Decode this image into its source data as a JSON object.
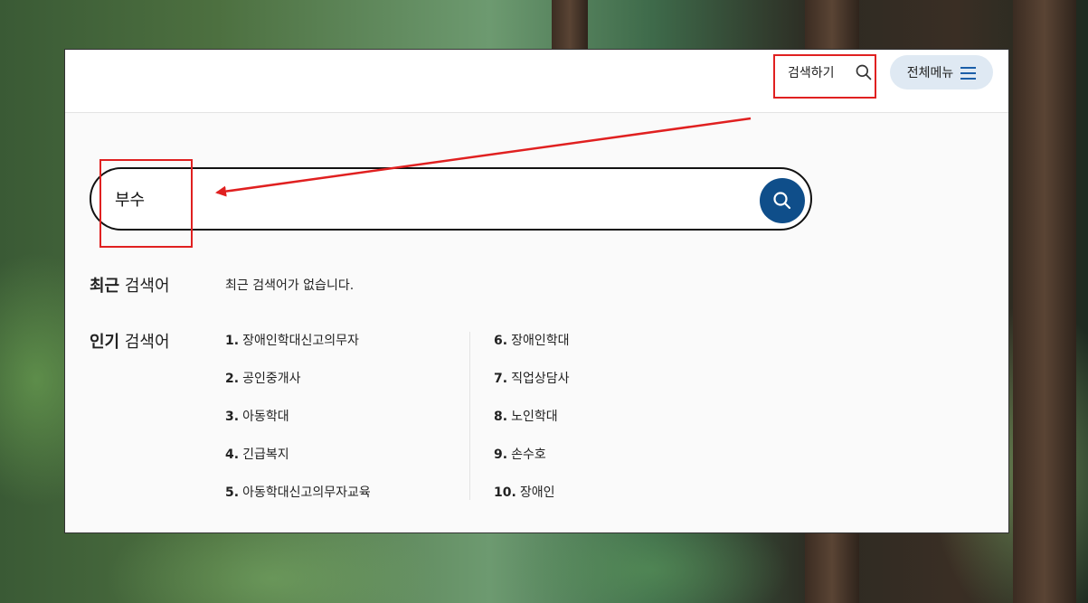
{
  "header": {
    "search_toggle_label": "검색하기",
    "menu_label": "전체메뉴"
  },
  "search": {
    "value": "부수"
  },
  "recent": {
    "label_bold": "최근",
    "label_rest": " 검색어",
    "empty_text": "최근 검색어가 없습니다."
  },
  "popular": {
    "label_bold": "인기",
    "label_rest": " 검색어",
    "items": [
      {
        "num": "1.",
        "text": "장애인학대신고의무자"
      },
      {
        "num": "2.",
        "text": "공인중개사"
      },
      {
        "num": "3.",
        "text": "아동학대"
      },
      {
        "num": "4.",
        "text": "긴급복지"
      },
      {
        "num": "5.",
        "text": "아동학대신고의무자교육"
      },
      {
        "num": "6.",
        "text": "장애인학대"
      },
      {
        "num": "7.",
        "text": "직업상담사"
      },
      {
        "num": "8.",
        "text": "노인학대"
      },
      {
        "num": "9.",
        "text": "손수호"
      },
      {
        "num": "10.",
        "text": "장애인"
      }
    ]
  },
  "colors": {
    "accent": "#0f4e8a",
    "menu_bg": "#dfe9f3",
    "annotation": "#e02020"
  },
  "icons": {
    "search": "search-icon",
    "menu": "hamburger-icon"
  }
}
